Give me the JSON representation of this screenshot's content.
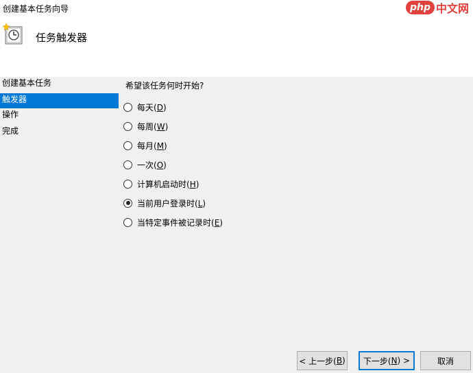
{
  "window": {
    "title": "创建基本任务向导"
  },
  "watermark": {
    "php": "php",
    "cn": "中文网"
  },
  "header": {
    "title": "任务触发器",
    "icon": "task-scheduler-clock-icon"
  },
  "nav": {
    "items": [
      {
        "label": "创建基本任务",
        "active": false
      },
      {
        "label": "触发器",
        "active": true
      },
      {
        "label": "操作",
        "active": false
      },
      {
        "label": "完成",
        "active": false
      }
    ]
  },
  "main": {
    "question": "希望该任务何时开始?",
    "options": [
      {
        "text": "每天(",
        "key": "D",
        "close": ")",
        "checked": false
      },
      {
        "text": "每周(",
        "key": "W",
        "close": ")",
        "checked": false
      },
      {
        "text": "每月(",
        "key": "M",
        "close": ")",
        "checked": false
      },
      {
        "text": "一次(",
        "key": "O",
        "close": ")",
        "checked": false
      },
      {
        "text": "计算机启动时(",
        "key": "H",
        "close": ")",
        "checked": false
      },
      {
        "text": "当前用户登录时(",
        "key": "L",
        "close": ")",
        "checked": true
      },
      {
        "text": "当特定事件被记录时(",
        "key": "E",
        "close": ")",
        "checked": false
      }
    ]
  },
  "buttons": {
    "back": {
      "pre": "< 上一步(",
      "key": "B",
      "post": ")"
    },
    "next": {
      "pre": "下一步(",
      "key": "N",
      "post": ") >"
    },
    "cancel": {
      "label": "取消"
    }
  }
}
